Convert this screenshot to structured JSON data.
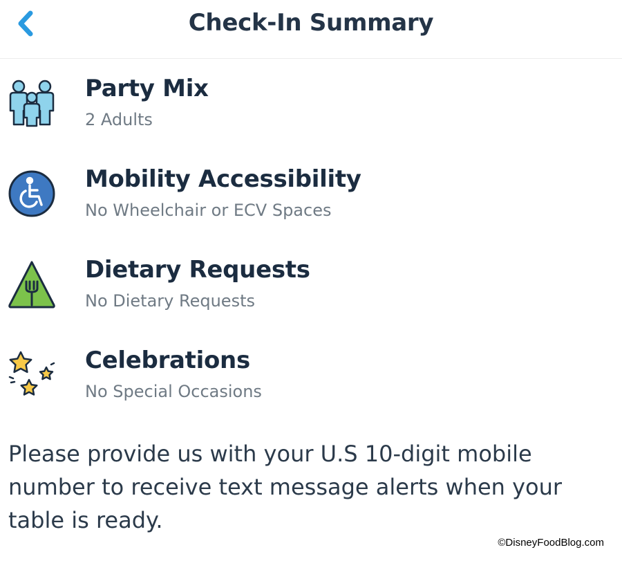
{
  "header": {
    "title": "Check-In Summary",
    "back_icon": "chevron-left-icon"
  },
  "items": [
    {
      "label": "Party Mix",
      "value": "2 Adults",
      "icon": "family-icon"
    },
    {
      "label": "Mobility Accessibility",
      "value": "No Wheelchair or ECV Spaces",
      "icon": "wheelchair-icon"
    },
    {
      "label": "Dietary Requests",
      "value": "No Dietary Requests",
      "icon": "fork-icon"
    },
    {
      "label": "Celebrations",
      "value": "No Special Occasions",
      "icon": "stars-icon"
    }
  ],
  "notice": "Please provide us with your U.S 10-digit mobile number to receive text message alerts when your table is ready.",
  "watermark": "©DisneyFoodBlog.com",
  "colors": {
    "accent_blue": "#2a9ae0",
    "title": "#243447",
    "subtitle": "#6f7a84",
    "family_fill": "#8fd3ec",
    "wheelchair_fill": "#3e79c2",
    "dietary_fill": "#7cc24b",
    "star_fill": "#f7c948"
  }
}
